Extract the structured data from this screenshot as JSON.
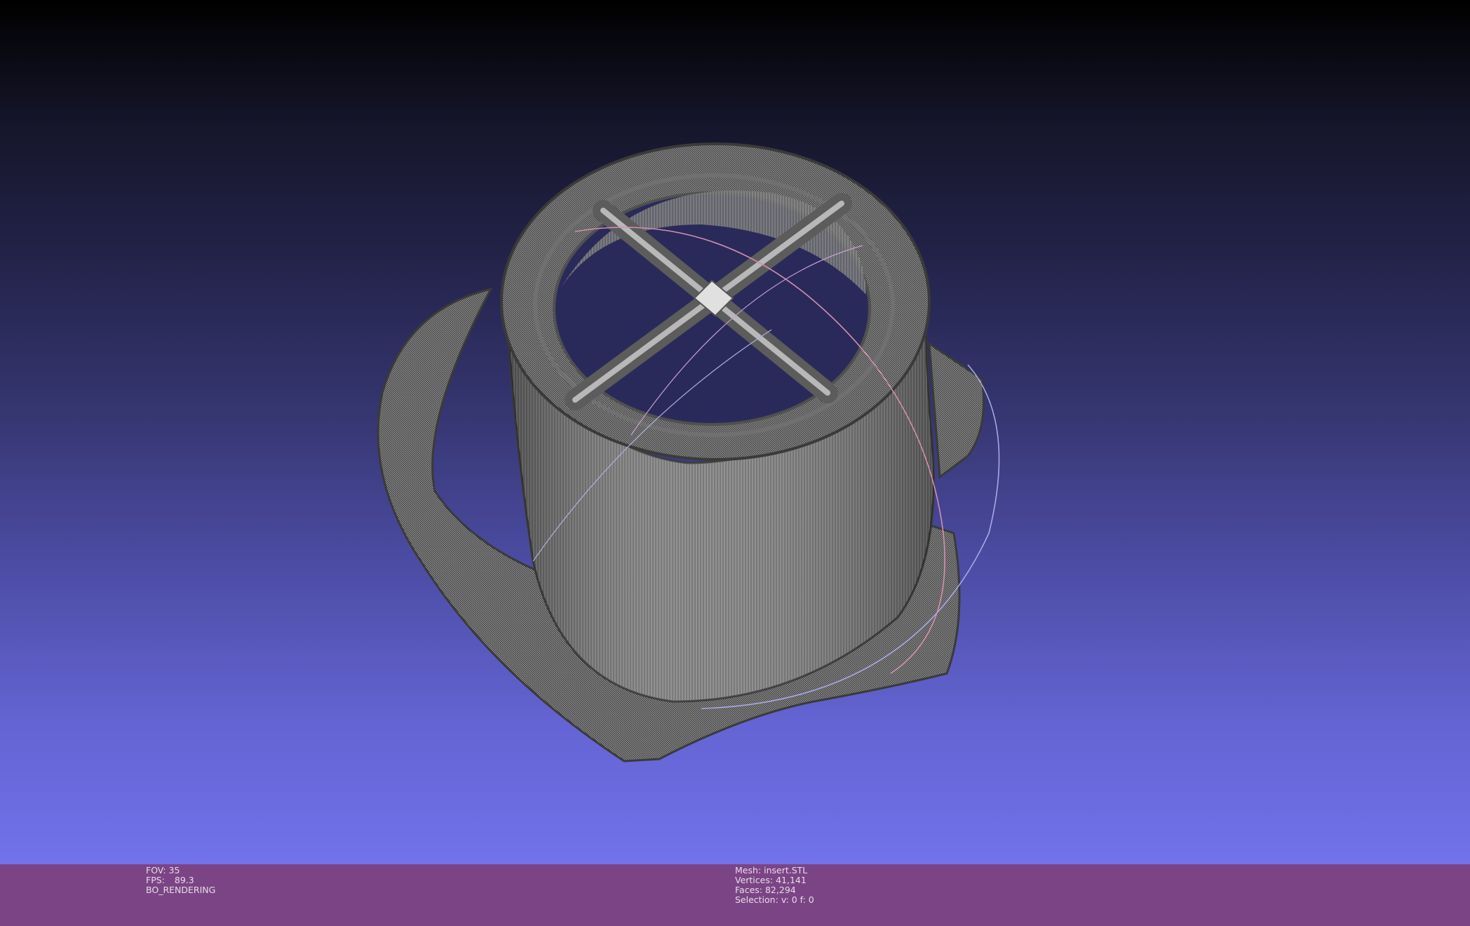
{
  "viewer": {
    "background_top": "#000000",
    "background_bottom": "#7272ea",
    "statusbar_color": "#7b4585",
    "mesh_color": "#8a8a8a",
    "trackball_colors": [
      "#d48fb0",
      "#a8a8e8",
      "#c8a0d0"
    ]
  },
  "status_left": {
    "fov_label": "FOV:",
    "fov_value": "35",
    "fps_label": "FPS:",
    "fps_value": "89.3",
    "render_mode": "BO_RENDERING"
  },
  "status_center": {
    "mesh_label": "Mesh:",
    "mesh_value": "insert.STL",
    "vertices_label": "Vertices:",
    "vertices_value": "41,141",
    "faces_label": "Faces:",
    "faces_value": "82,294",
    "selection_label": "Selection:",
    "selection_value": "v: 0 f: 0"
  }
}
